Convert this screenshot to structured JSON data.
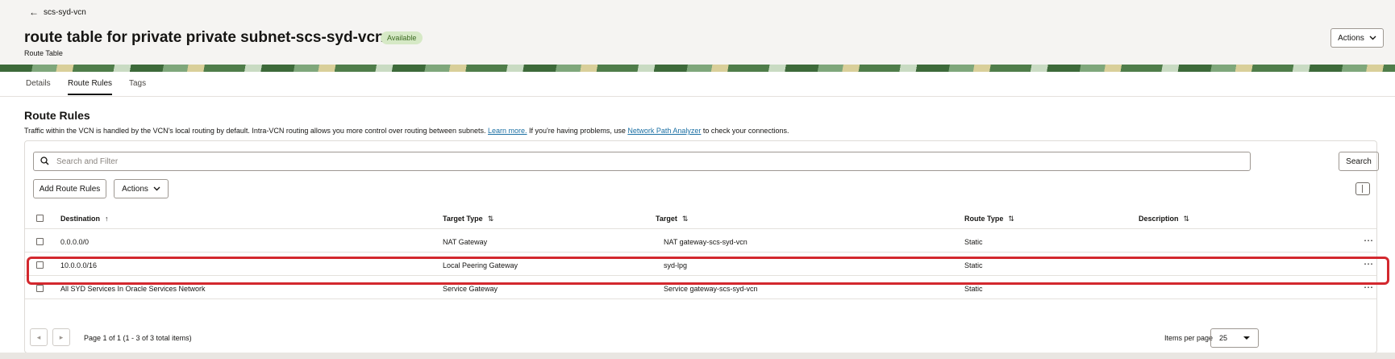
{
  "breadcrumb": {
    "back_label": "scs-syd-vcn"
  },
  "header": {
    "title": "route table for private private subnet-scs-syd-vcn",
    "status_badge": "Available",
    "subtitle": "Route Table",
    "actions_label": "Actions"
  },
  "tabs": [
    {
      "label": "Details"
    },
    {
      "label": "Route Rules",
      "active": true
    },
    {
      "label": "Tags"
    }
  ],
  "section": {
    "title": "Route Rules",
    "desc_part1": "Traffic within the VCN is handled by the VCN's local routing by default. Intra-VCN routing allows you more control over routing between subnets. ",
    "learn_more": "Learn more.",
    "desc_part2": " If you're having problems, use ",
    "analyzer_link": "Network Path Analyzer",
    "desc_part3": " to check your connections."
  },
  "search": {
    "placeholder": "Search and Filter",
    "button_label": "Search"
  },
  "toolbar": {
    "add_label": "Add Route Rules",
    "actions_label": "Actions"
  },
  "table": {
    "columns": {
      "destination": "Destination",
      "target_type": "Target Type",
      "target": "Target",
      "route_type": "Route Type",
      "description": "Description"
    },
    "rows": [
      {
        "destination": "0.0.0.0/0",
        "target_type": "NAT Gateway",
        "target": "NAT gateway-scs-syd-vcn",
        "route_type": "Static",
        "description": ""
      },
      {
        "destination": "10.0.0.0/16",
        "target_type": "Local Peering Gateway",
        "target": "syd-lpg",
        "route_type": "Static",
        "description": ""
      },
      {
        "destination": "All SYD Services In Oracle Services Network",
        "target_type": "Service Gateway",
        "target": "Service gateway-scs-syd-vcn",
        "route_type": "Static",
        "description": ""
      }
    ]
  },
  "pagination": {
    "page_info": "Page 1 of 1 (1 - 3 of 3 total items)",
    "items_per_page_label": "Items per page",
    "items_per_page_value": "25"
  },
  "colors": {
    "highlight": "#d3282e",
    "badge_bg": "#d6e9c6",
    "link": "#1a6fa3"
  },
  "icons": {
    "back": "arrow-left-icon",
    "search": "search-icon",
    "chevron": "chevron-down-icon",
    "sort": "sort-icon",
    "kebab": "more-actions-icon",
    "columns": "column-toggle-icon"
  }
}
